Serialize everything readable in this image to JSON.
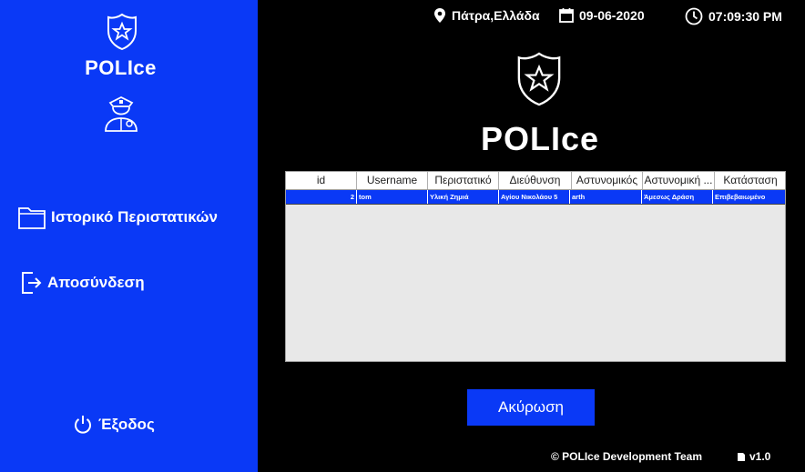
{
  "sidebar": {
    "app_name": "POLIce",
    "nav": {
      "history_label": "Ιστορικό Περιστατικών",
      "logout_label": "Αποσύνδεση",
      "exit_label": "Έξοδος"
    }
  },
  "header": {
    "location": "Πάτρα,Ελλάδα",
    "date": "09-06-2020",
    "time": "07:09:30 PM"
  },
  "main": {
    "title": "POLIce",
    "cancel_label": "Ακύρωση"
  },
  "table": {
    "columns": [
      "id",
      "Username",
      "Περιστατικό",
      "Διεύθυνση",
      "Αστυνομικός",
      "Αστυνομική ...",
      "Κατάσταση"
    ],
    "rows": [
      [
        "2",
        "tom",
        "Υλική Ζημιά",
        "Αγίου Νικολάου 5",
        "arth",
        "Άμεσως Δράση",
        "Επιβεβαιωμένο"
      ]
    ],
    "selected_row_color": "#0a39f6"
  },
  "footer": {
    "copyright": "© POLIce Development Team",
    "version": "v1.0"
  },
  "colors": {
    "accent": "#0a39f6",
    "background": "#000000"
  }
}
